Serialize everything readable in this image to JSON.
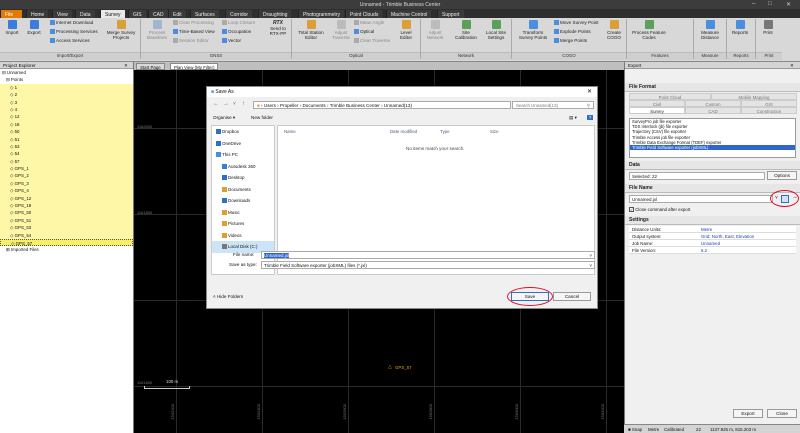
{
  "window": {
    "title": "Unnamed - Trimble Business Center"
  },
  "tabs": [
    "File",
    "Home",
    "View",
    "Data",
    "Survey",
    "GIS",
    "CAD",
    "Edit",
    "Surfaces",
    "Corridor",
    "Draughting",
    "Photogrammetry",
    "Point Clouds",
    "Machine Control",
    "Support"
  ],
  "ribbon": {
    "import": "Import",
    "export": "Export",
    "internet_download": "Internet Download",
    "processing_services": "Processing Services",
    "access_services": "Access Services",
    "merge_survey_projects": "Merge Survey Projects",
    "import_export_group": "Import/Export",
    "process_baselines": "Process Baselines",
    "clear_processing": "Clear Processing",
    "time_based_view": "Time-Based View",
    "session_editor": "Session Editor",
    "loop_closure": "Loop Closure",
    "occupation": "Occupation",
    "vector": "Vector",
    "send_to": "Send to RTX-PP",
    "rtx": "RTX",
    "gnss_group": "GNSS",
    "total_station_editor": "Total Station Editor",
    "adjust_traverse": "Adjust Traverse",
    "mean_angle": "Mean Angle",
    "optical": "Optical",
    "clear_traverse": "Clear Traverse",
    "level_editor": "Level Editor",
    "optical_group": "Optical",
    "adjust_network": "Adjust Network",
    "site_calibration": "Site Calibration",
    "local_site_settings": "Local Site Settings",
    "network_group": "Network",
    "transform_survey_points": "Transform Survey Points",
    "move_survey_point": "Move Survey Point",
    "explode_points": "Explode Points",
    "merge_points": "Merge Points",
    "create_cogo": "Create COGO",
    "cogo_group": "COGO",
    "process_feature_codes": "Process Feature Codes",
    "features_group": "Features",
    "measure_distance": "Measure Distance",
    "measure_group": "Measure",
    "reports": "Reports",
    "reports_group": "Reports",
    "print": "Print",
    "print_group": "Print"
  },
  "project_explorer": {
    "title": "Project Explorer",
    "root": "Unnamed",
    "points": "Points",
    "items": [
      "1",
      "2",
      "3",
      "4",
      "12",
      "18",
      "50",
      "51",
      "53",
      "54",
      "57",
      "GPS_1",
      "GPS_2",
      "GPS_3",
      "GPS_4",
      "GPS_12",
      "GPS_18",
      "GPS_50",
      "GPS_51",
      "GPS_53",
      "GPS_54",
      "GPS_57"
    ],
    "imported": "Imported Files"
  },
  "view": {
    "tabs": [
      "Start Page",
      "Plan View (My Filter)"
    ],
    "scale": "100 m",
    "point_label": "GPS_57",
    "y_coords": [
      "1162000",
      "1161800",
      "1161600"
    ],
    "x_coords": [
      "1502200",
      "1502400",
      "1502600",
      "1502800",
      "1503000",
      "1503200"
    ]
  },
  "dialog": {
    "title": "Save As",
    "breadcrumb": [
      "Users",
      "Propeller",
      "Documents",
      "Trimble Business Center",
      "Unnamed(13)"
    ],
    "search_placeholder": "Search Unnamed(13)",
    "organise": "Organise",
    "new_folder": "New folder",
    "nav": [
      "Dropbox",
      "OneDrive",
      "This PC",
      "Autodesk 360",
      "Desktop",
      "Documents",
      "Downloads",
      "Music",
      "Pictures",
      "Videos",
      "Local Disk (C:)"
    ],
    "columns": [
      "Name",
      "Date modified",
      "Type",
      "Size"
    ],
    "empty": "No items match your search.",
    "file_name_label": "File name:",
    "file_name": "Unnamed.jxl",
    "save_type_label": "Save as type:",
    "save_type": "Trimble Field Software exporter (jobXML) files (*.jxl)",
    "hide_folders": "Hide Folders",
    "save": "Save",
    "cancel": "Cancel"
  },
  "export_panel": {
    "title": "Export",
    "file_format": "File Format",
    "tabs_row1": [
      "Point Cloud",
      "Mobile Mapping"
    ],
    "tabs_row2": [
      "Civil",
      "Custom",
      "GIS"
    ],
    "tabs_row3": [
      "Survey",
      "CAD",
      "Construction"
    ],
    "formats": [
      "SurveyPro job file exporter",
      "TDS Interlock (jb) file exporter",
      "Trajectory (CSV) file exporter",
      "Trimble Access job file exporter",
      "Trimble Data Exchange Format (TDEF) exporter",
      "Trimble Field Software exporter (jobXML)"
    ],
    "data": "Data",
    "selected": "Selected: 22",
    "options": "Options",
    "file_name": "File Name",
    "file_value": "Unnamed.jxl",
    "close_after": "Close command after export",
    "settings": "Settings",
    "settings_rows": [
      {
        "k": "Distance Units:",
        "v": "Metre"
      },
      {
        "k": "Output system:",
        "v": "Grid: North, East, Elevation"
      },
      {
        "k": "Job Name:",
        "v": "Unnamed"
      },
      {
        "k": "File Version:",
        "v": "5.2"
      }
    ],
    "export": "Export",
    "close": "Close"
  },
  "status": {
    "snap": "Snap",
    "metre": "Metre",
    "calibrated": "Calibrated",
    "count": "22",
    "coords": "1137.925 m, 815.203 m"
  },
  "colors": {
    "accent": "#e07b00",
    "selection": "#3066cc",
    "highlight": "#fff7a8",
    "annotation": "#e0112b"
  }
}
